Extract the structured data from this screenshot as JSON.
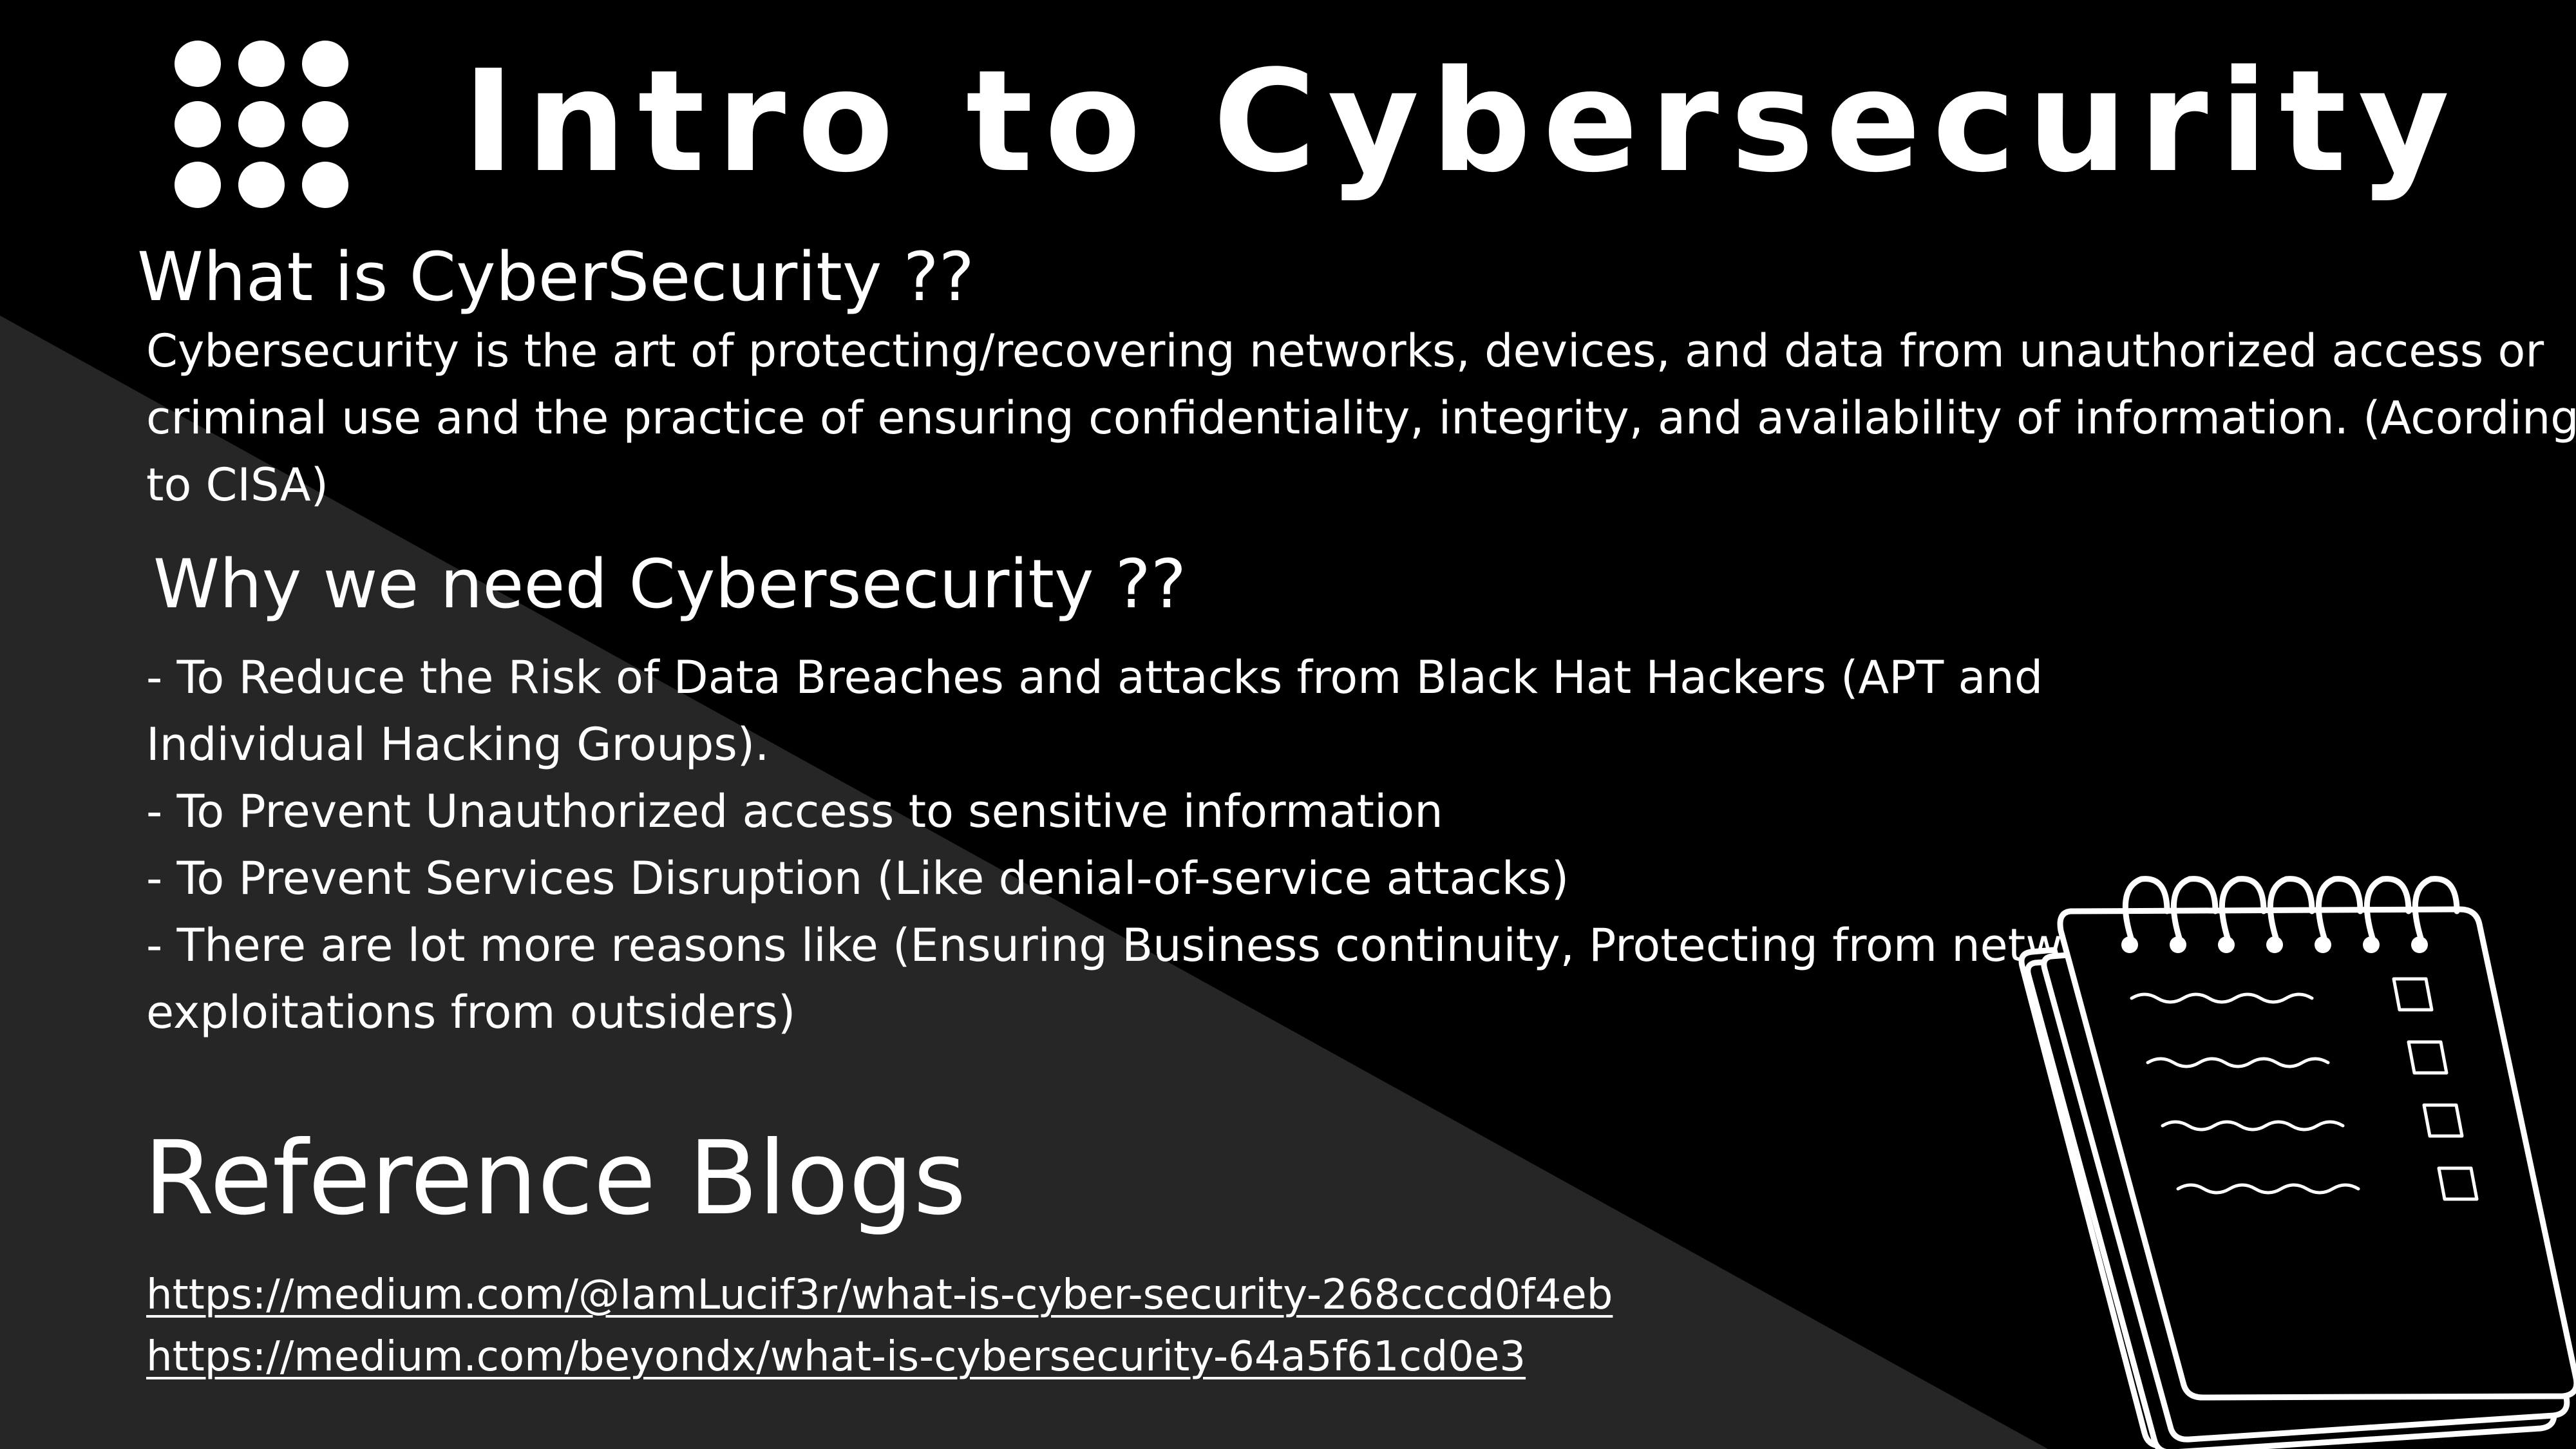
{
  "slide": {
    "title": "Intro to Cybersecurity",
    "sections": {
      "what": {
        "heading": "What is CyberSecurity ??",
        "lines": [
          "Cybersecurity is the art of protecting/recovering networks, devices, and data from unauthorized access or",
          "criminal use and the practice of ensuring confidentiality, integrity, and availability of information. (Acording",
          "to CISA)"
        ]
      },
      "why": {
        "heading": "Why we need Cybersecurity ??",
        "lines": [
          "- To Reduce the Risk of Data Breaches and attacks from Black Hat Hackers (APT and",
          "Individual Hacking Groups).",
          "- To Prevent Unauthorized access to sensitive information",
          "- To Prevent Services Disruption (Like denial-of-service attacks)",
          "- There are lot more reasons like (Ensuring  Business continuity, Protecting from  network",
          "exploitations from outsiders)"
        ]
      }
    },
    "references": {
      "heading": "Reference Blogs",
      "links": [
        "https://medium.com/@IamLucif3r/what-is-cyber-security-268cccd0f4eb",
        "https://medium.com/beyondx/what-is-cybersecurity-64a5f61cd0e3"
      ]
    }
  },
  "icons": {
    "logo": "dot-grid-icon",
    "illustration": "notepad-checklist-icon"
  },
  "colors": {
    "background": "#000000",
    "diagonal_panel": "#262626",
    "text": "#ffffff"
  }
}
